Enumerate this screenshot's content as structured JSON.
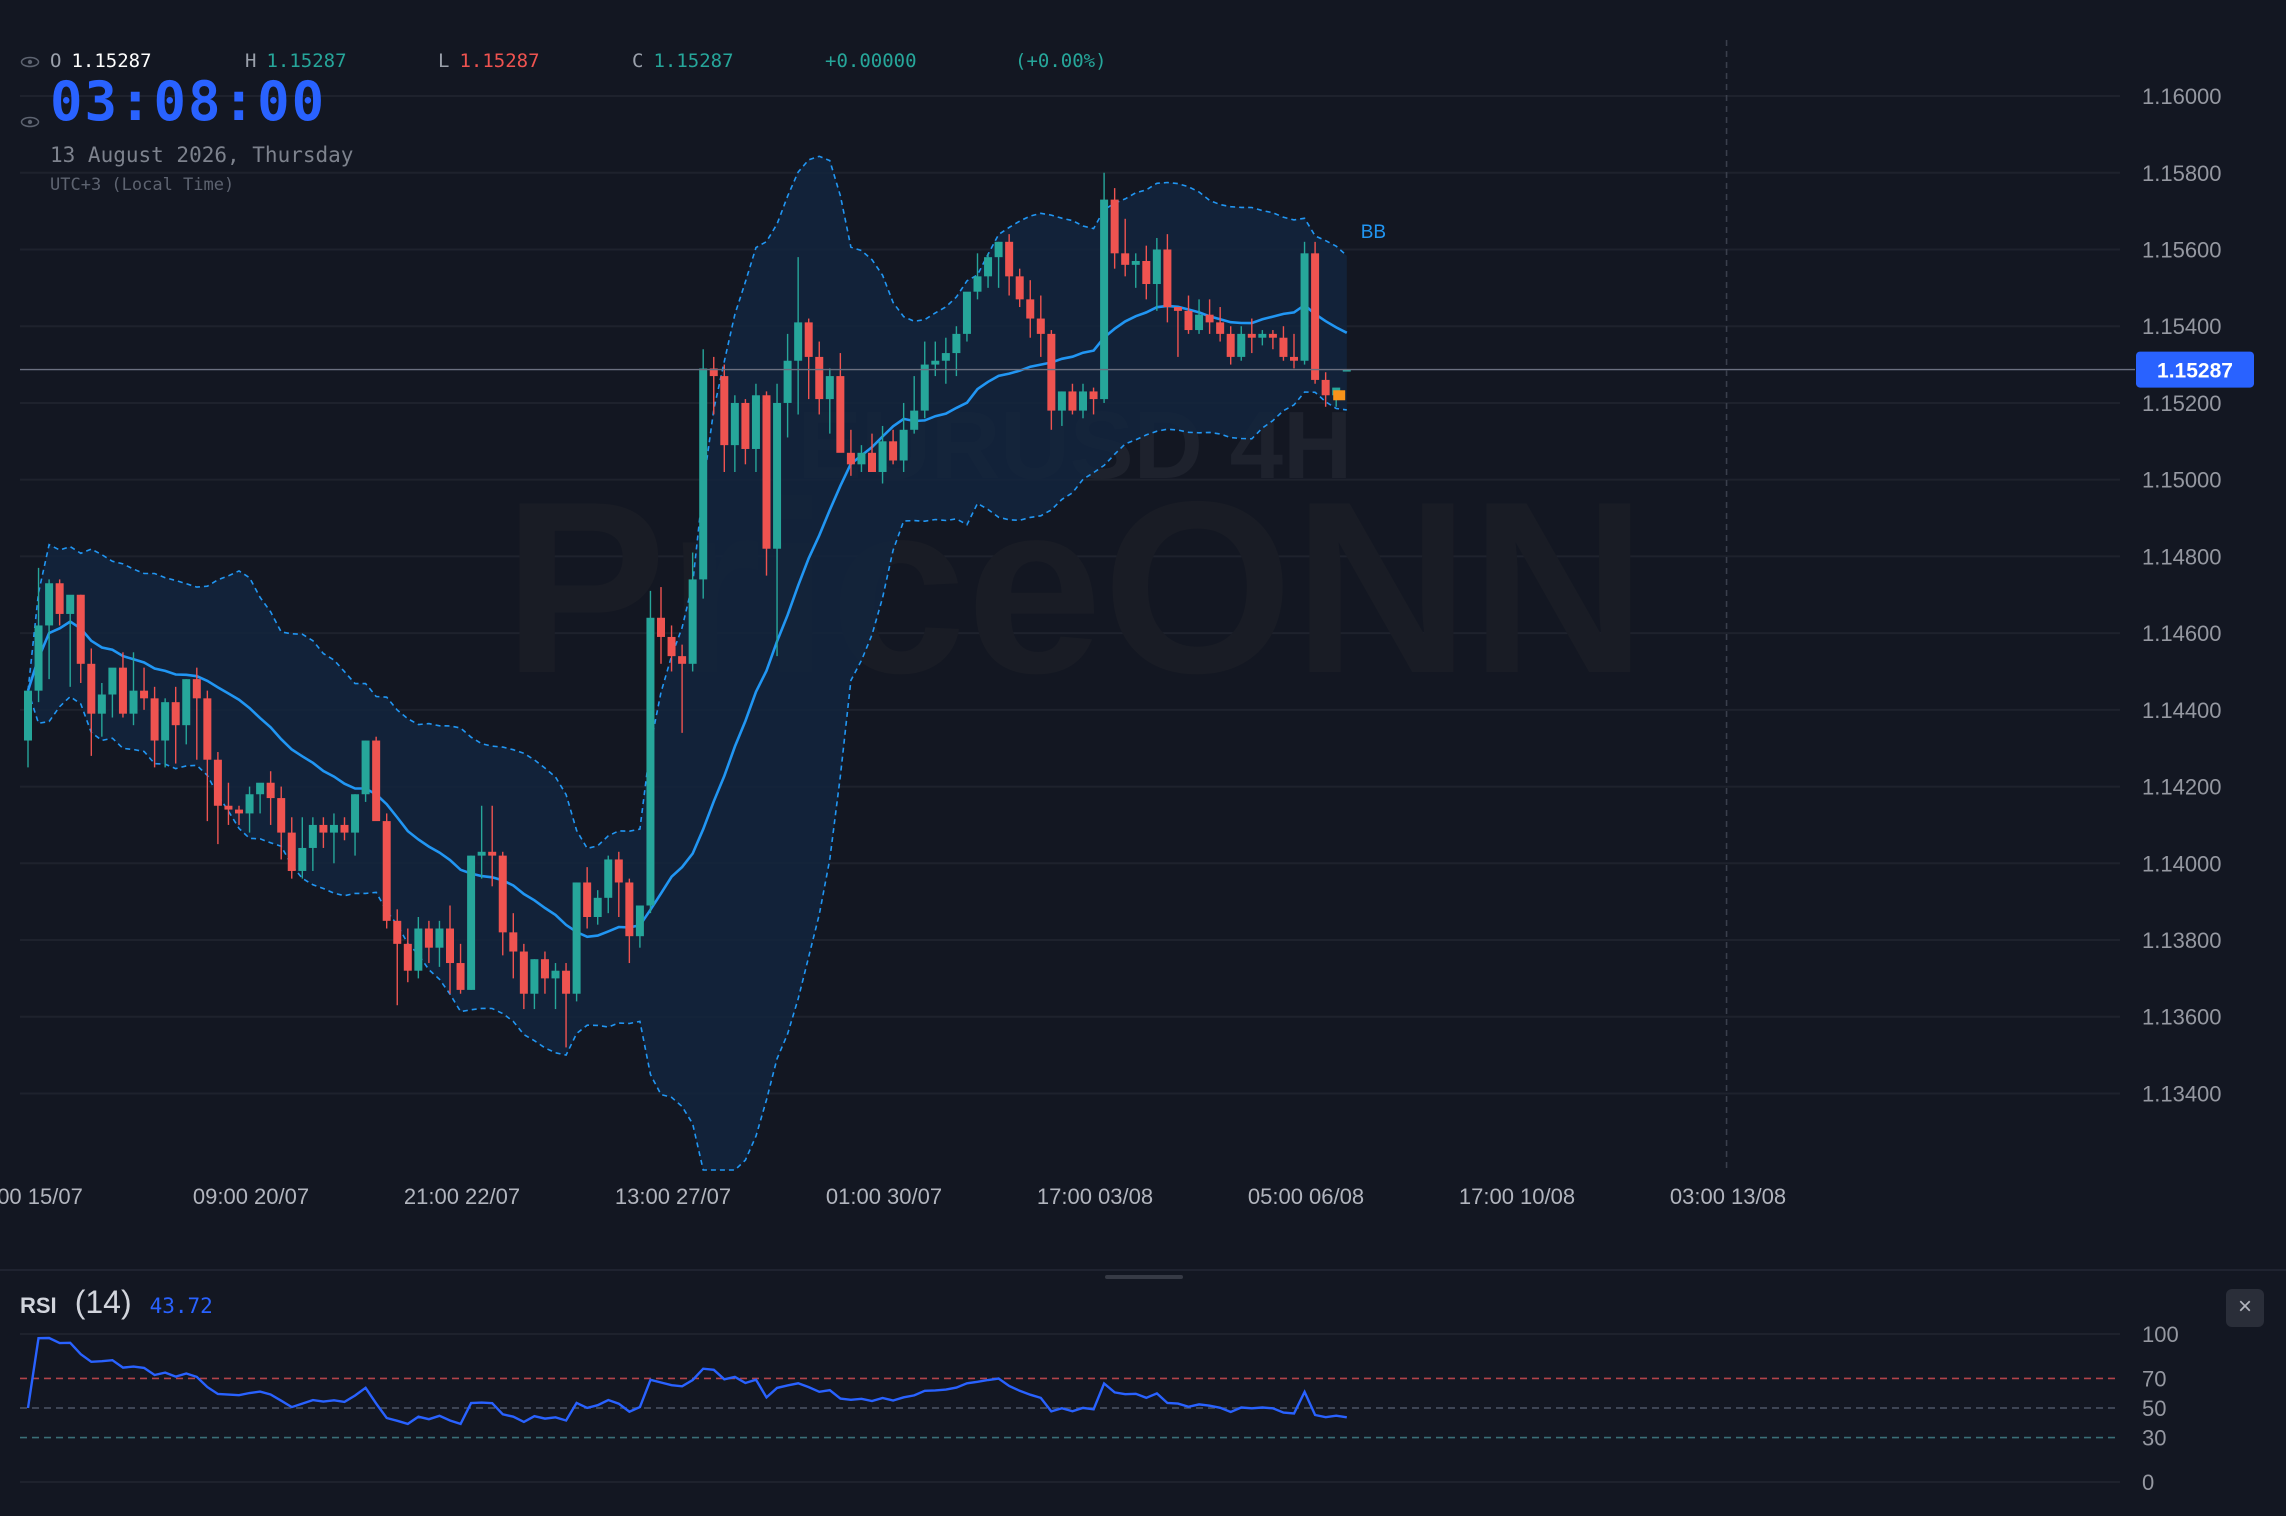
{
  "ohlc": {
    "o_label": "O",
    "o_value": "1.15287",
    "h_label": "H",
    "h_value": "1.15287",
    "l_label": "L",
    "l_value": "1.15287",
    "c_label": "C",
    "c_value": "1.15287",
    "change": "+0.00000",
    "change_pct": "(+0.00%)"
  },
  "clock": "03:08:00",
  "date": "13 August 2026, Thursday",
  "timezone": "UTC+3 (Local Time)",
  "watermark": {
    "line1": "EURUSD 4H",
    "line2": "PriceONN"
  },
  "indicator_label": "BB",
  "price_tag": "1.15287",
  "rsi": {
    "name": "RSI",
    "period": "(14)",
    "value": "43.72",
    "close": "×"
  },
  "colors": {
    "background": "#131722",
    "up": "#26a69a",
    "down": "#ef5350",
    "bb_line": "#2196f3",
    "bb_fill": "#13243d",
    "rsi_line": "#2962ff",
    "price_tag": "#2962ff",
    "grid": "#1e222d"
  },
  "chart_data": [
    {
      "type": "candlestick",
      "symbol": "EURUSD",
      "timeframe": "4H",
      "y_ticks": [
        "1.16000",
        "1.15800",
        "1.15600",
        "1.15400",
        "1.15200",
        "1.15000",
        "1.14800",
        "1.14600",
        "1.14400",
        "1.14200",
        "1.14000",
        "1.13800",
        "1.13600",
        "1.13400"
      ],
      "ylim": [
        1.1331,
        1.1612
      ],
      "x_ticks": [
        "00 15/07",
        "09:00 20/07",
        "21:00 22/07",
        "13:00 27/07",
        "01:00 30/07",
        "17:00 03/08",
        "05:00 06/08",
        "17:00 10/08",
        "03:00 13/08"
      ],
      "x_tick_index": [
        0,
        20,
        40,
        60,
        80,
        100,
        120,
        140,
        160
      ],
      "last_price": 1.15287,
      "candles": [
        [
          1.1432,
          1.1445,
          1.1425,
          1.1445
        ],
        [
          1.1445,
          1.1477,
          1.1442,
          1.1462
        ],
        [
          1.1462,
          1.1474,
          1.1448,
          1.1473
        ],
        [
          1.1473,
          1.1474,
          1.1462,
          1.1465
        ],
        [
          1.1465,
          1.1469,
          1.1446,
          1.147
        ],
        [
          1.147,
          1.147,
          1.1447,
          1.1452
        ],
        [
          1.1452,
          1.1456,
          1.1428,
          1.1439
        ],
        [
          1.1439,
          1.1447,
          1.1433,
          1.1444
        ],
        [
          1.1444,
          1.1447,
          1.1438,
          1.1451
        ],
        [
          1.1451,
          1.1455,
          1.1438,
          1.1439
        ],
        [
          1.1439,
          1.1455,
          1.1436,
          1.1445
        ],
        [
          1.1445,
          1.1451,
          1.144,
          1.1443
        ],
        [
          1.1443,
          1.1446,
          1.1425,
          1.1432
        ],
        [
          1.1432,
          1.1443,
          1.1425,
          1.1442
        ],
        [
          1.1442,
          1.1446,
          1.1426,
          1.1436
        ],
        [
          1.1436,
          1.1448,
          1.1431,
          1.1448
        ],
        [
          1.1448,
          1.1451,
          1.1427,
          1.1443
        ],
        [
          1.1443,
          1.1445,
          1.1411,
          1.1427
        ],
        [
          1.1427,
          1.1429,
          1.1405,
          1.1415
        ],
        [
          1.1415,
          1.1421,
          1.141,
          1.1414
        ],
        [
          1.1414,
          1.1415,
          1.141,
          1.1413
        ],
        [
          1.1413,
          1.142,
          1.1408,
          1.1418
        ],
        [
          1.1418,
          1.142,
          1.1413,
          1.1421
        ],
        [
          1.1421,
          1.1424,
          1.141,
          1.1417
        ],
        [
          1.1417,
          1.142,
          1.1401,
          1.1408
        ],
        [
          1.1408,
          1.1412,
          1.1396,
          1.1398
        ],
        [
          1.1398,
          1.1412,
          1.1396,
          1.1404
        ],
        [
          1.1404,
          1.1412,
          1.1398,
          1.141
        ],
        [
          1.141,
          1.1412,
          1.1404,
          1.1408
        ],
        [
          1.1408,
          1.1413,
          1.14,
          1.141
        ],
        [
          1.141,
          1.1412,
          1.1406,
          1.1408
        ],
        [
          1.1408,
          1.1418,
          1.1402,
          1.1418
        ],
        [
          1.1418,
          1.1432,
          1.1416,
          1.1432
        ],
        [
          1.1432,
          1.1433,
          1.1412,
          1.1411
        ],
        [
          1.1411,
          1.1413,
          1.1383,
          1.1385
        ],
        [
          1.1385,
          1.1388,
          1.1363,
          1.1379
        ],
        [
          1.1379,
          1.1383,
          1.1369,
          1.1372
        ],
        [
          1.1372,
          1.1386,
          1.137,
          1.1383
        ],
        [
          1.1383,
          1.1385,
          1.1374,
          1.1378
        ],
        [
          1.1378,
          1.1385,
          1.1373,
          1.1383
        ],
        [
          1.1383,
          1.1389,
          1.1366,
          1.1374
        ],
        [
          1.1374,
          1.1379,
          1.1366,
          1.1367
        ],
        [
          1.1367,
          1.1402,
          1.1367,
          1.1402
        ],
        [
          1.1402,
          1.1415,
          1.1396,
          1.1403
        ],
        [
          1.1403,
          1.1415,
          1.1394,
          1.1402
        ],
        [
          1.1402,
          1.1403,
          1.1376,
          1.1382
        ],
        [
          1.1382,
          1.1387,
          1.137,
          1.1377
        ],
        [
          1.1377,
          1.1379,
          1.1362,
          1.1366
        ],
        [
          1.1366,
          1.1375,
          1.1362,
          1.1375
        ],
        [
          1.1375,
          1.1377,
          1.1366,
          1.137
        ],
        [
          1.137,
          1.1374,
          1.1362,
          1.1372
        ],
        [
          1.1372,
          1.1374,
          1.1352,
          1.1366
        ],
        [
          1.1366,
          1.1395,
          1.1364,
          1.1395
        ],
        [
          1.1395,
          1.1399,
          1.1383,
          1.1386
        ],
        [
          1.1386,
          1.1393,
          1.1384,
          1.1391
        ],
        [
          1.1391,
          1.1402,
          1.1387,
          1.1401
        ],
        [
          1.1401,
          1.1403,
          1.1386,
          1.1395
        ],
        [
          1.1395,
          1.1396,
          1.1374,
          1.1381
        ],
        [
          1.1381,
          1.1389,
          1.1378,
          1.1389
        ],
        [
          1.1389,
          1.1471,
          1.1387,
          1.1464
        ],
        [
          1.1464,
          1.1472,
          1.1452,
          1.1459
        ],
        [
          1.1459,
          1.1462,
          1.145,
          1.1454
        ],
        [
          1.1454,
          1.1457,
          1.1434,
          1.1452
        ],
        [
          1.1452,
          1.1481,
          1.145,
          1.1474
        ],
        [
          1.1474,
          1.1534,
          1.1469,
          1.1529
        ],
        [
          1.1529,
          1.1532,
          1.1517,
          1.1527
        ],
        [
          1.1527,
          1.153,
          1.1502,
          1.1509
        ],
        [
          1.1509,
          1.1522,
          1.1502,
          1.152
        ],
        [
          1.152,
          1.1521,
          1.1504,
          1.1508
        ],
        [
          1.1508,
          1.1525,
          1.1502,
          1.1522
        ],
        [
          1.1522,
          1.1523,
          1.1475,
          1.1482
        ],
        [
          1.1482,
          1.1525,
          1.1454,
          1.152
        ],
        [
          1.152,
          1.1538,
          1.1511,
          1.1531
        ],
        [
          1.1531,
          1.1558,
          1.1517,
          1.1541
        ],
        [
          1.1541,
          1.1542,
          1.1521,
          1.1532
        ],
        [
          1.1532,
          1.1536,
          1.1517,
          1.1521
        ],
        [
          1.1521,
          1.1529,
          1.1512,
          1.1527
        ],
        [
          1.1527,
          1.1533,
          1.151,
          1.1507
        ],
        [
          1.1507,
          1.1513,
          1.1501,
          1.1504
        ],
        [
          1.1504,
          1.1509,
          1.1502,
          1.1507
        ],
        [
          1.1507,
          1.1512,
          1.1502,
          1.1502
        ],
        [
          1.1502,
          1.1514,
          1.1499,
          1.151
        ],
        [
          1.151,
          1.1513,
          1.1504,
          1.1505
        ],
        [
          1.1505,
          1.152,
          1.1502,
          1.1513
        ],
        [
          1.1513,
          1.1527,
          1.1512,
          1.1518
        ],
        [
          1.1518,
          1.1536,
          1.1516,
          1.153
        ],
        [
          1.153,
          1.1536,
          1.1527,
          1.1531
        ],
        [
          1.1531,
          1.1537,
          1.1525,
          1.1533
        ],
        [
          1.1533,
          1.154,
          1.1527,
          1.1538
        ],
        [
          1.1538,
          1.1548,
          1.1536,
          1.1549
        ],
        [
          1.1549,
          1.1559,
          1.1547,
          1.1553
        ],
        [
          1.1553,
          1.1559,
          1.155,
          1.1558
        ],
        [
          1.1558,
          1.1562,
          1.155,
          1.1562
        ],
        [
          1.1562,
          1.1564,
          1.1548,
          1.1553
        ],
        [
          1.1553,
          1.1555,
          1.1545,
          1.1547
        ],
        [
          1.1547,
          1.1552,
          1.1537,
          1.1542
        ],
        [
          1.1542,
          1.1548,
          1.1532,
          1.1538
        ],
        [
          1.1538,
          1.1539,
          1.1513,
          1.1518
        ],
        [
          1.1518,
          1.1523,
          1.1514,
          1.1523
        ],
        [
          1.1523,
          1.1525,
          1.1517,
          1.1518
        ],
        [
          1.1518,
          1.1525,
          1.1516,
          1.1523
        ],
        [
          1.1523,
          1.1524,
          1.1517,
          1.1521
        ],
        [
          1.1521,
          1.158,
          1.152,
          1.1573
        ],
        [
          1.1573,
          1.1576,
          1.1555,
          1.1559
        ],
        [
          1.1559,
          1.1568,
          1.1553,
          1.1556
        ],
        [
          1.1556,
          1.1559,
          1.155,
          1.1557
        ],
        [
          1.1557,
          1.1561,
          1.1547,
          1.1551
        ],
        [
          1.1551,
          1.1563,
          1.1544,
          1.156
        ],
        [
          1.156,
          1.1564,
          1.1541,
          1.1545
        ],
        [
          1.1545,
          1.1545,
          1.1532,
          1.1544
        ],
        [
          1.1544,
          1.1548,
          1.1538,
          1.1539
        ],
        [
          1.1539,
          1.1547,
          1.1538,
          1.1543
        ],
        [
          1.1543,
          1.1547,
          1.1538,
          1.1541
        ],
        [
          1.1541,
          1.1545,
          1.1536,
          1.1538
        ],
        [
          1.1538,
          1.154,
          1.153,
          1.1532
        ],
        [
          1.1532,
          1.154,
          1.1531,
          1.1538
        ],
        [
          1.1538,
          1.1542,
          1.1533,
          1.1537
        ],
        [
          1.1537,
          1.1539,
          1.1535,
          1.1538
        ],
        [
          1.1538,
          1.1539,
          1.1534,
          1.1537
        ],
        [
          1.1537,
          1.154,
          1.1531,
          1.1532
        ],
        [
          1.1532,
          1.1538,
          1.1529,
          1.1531
        ],
        [
          1.1531,
          1.1562,
          1.153,
          1.1559
        ],
        [
          1.1559,
          1.1562,
          1.1525,
          1.1526
        ],
        [
          1.1526,
          1.1528,
          1.1519,
          1.1522
        ],
        [
          1.1522,
          1.1523,
          1.1519,
          1.1524
        ],
        [
          1.15287,
          1.15287,
          1.15287,
          1.15287
        ]
      ],
      "bb": {
        "period": 20,
        "multiplier": 2
      },
      "current_time_index": 161
    },
    {
      "type": "line",
      "name": "RSI (14)",
      "y_ticks": [
        "100",
        "70",
        "50",
        "30",
        "0"
      ],
      "ylim": [
        0,
        100
      ],
      "levels": [
        70,
        50,
        30
      ],
      "last_value": 43.72
    }
  ]
}
